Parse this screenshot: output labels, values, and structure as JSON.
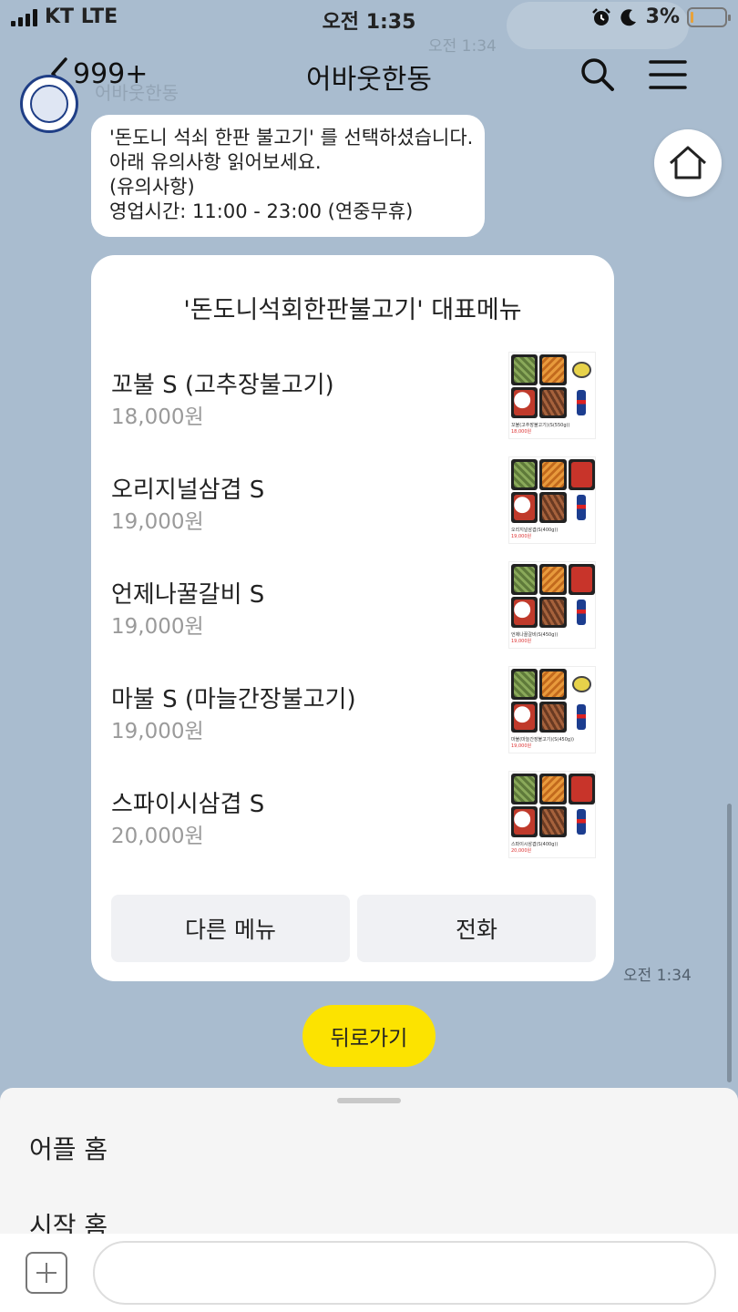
{
  "status_bar": {
    "carrier": "KT LTE",
    "time": "오전 1:35",
    "battery": "3%",
    "battery_level": 0.03,
    "icons": [
      "alarm-icon",
      "moon-icon"
    ]
  },
  "ghost_preview": {
    "time": "오전 1:34",
    "name": "어바웃한동"
  },
  "header": {
    "back_count": "999+",
    "title": "어바웃한동",
    "icons": [
      "chevron-left-icon",
      "search-icon",
      "menu-icon"
    ]
  },
  "home_button": {
    "icon": "home-icon"
  },
  "message": {
    "lines": [
      "'돈도니 석쇠 한판 불고기' 를 선택하셨습니다.",
      "아래 유의사항 읽어보세요.",
      "(유의사항)",
      "영업시간: 11:00 - 23:00 (연중무휴)"
    ]
  },
  "card": {
    "title": "'돈도니석회한판불고기' 대표메뉴",
    "items": [
      {
        "name": "꼬불 S (고추장불고기)",
        "price": "18,000원",
        "thumb_caption": "꼬불(고추장불고기)(S(550g))",
        "thumb_price": "18,000원"
      },
      {
        "name": "오리지널삼겹 S",
        "price": "19,000원",
        "thumb_caption": "오리지널삼겹(S(400g))",
        "thumb_price": "19,000원"
      },
      {
        "name": "언제나꿀갈비 S",
        "price": "19,000원",
        "thumb_caption": "언제나꿀갈비(S(450g))",
        "thumb_price": "19,000원"
      },
      {
        "name": "마불 S (마늘간장불고기)",
        "price": "19,000원",
        "thumb_caption": "마불(마늘간장불고기)(S(450g))",
        "thumb_price": "19,000원"
      },
      {
        "name": "스파이시삼겹 S",
        "price": "20,000원",
        "thumb_caption": "스파이시삼겹(S(400g))",
        "thumb_price": "20,000원"
      }
    ],
    "buttons": {
      "other_menu": "다른 메뉴",
      "call": "전화"
    }
  },
  "message_time": "오전 1:34",
  "quick_reply": {
    "back": "뒤로가기"
  },
  "bottom_sheet": {
    "items": [
      "어플 홈",
      "시작 홈"
    ]
  },
  "input": {
    "placeholder": "",
    "value": "",
    "plus_icon": "plus-icon"
  },
  "colors": {
    "background": "#a9bccf",
    "accent_yellow": "#fce300",
    "button_gray": "#f0f1f4"
  }
}
